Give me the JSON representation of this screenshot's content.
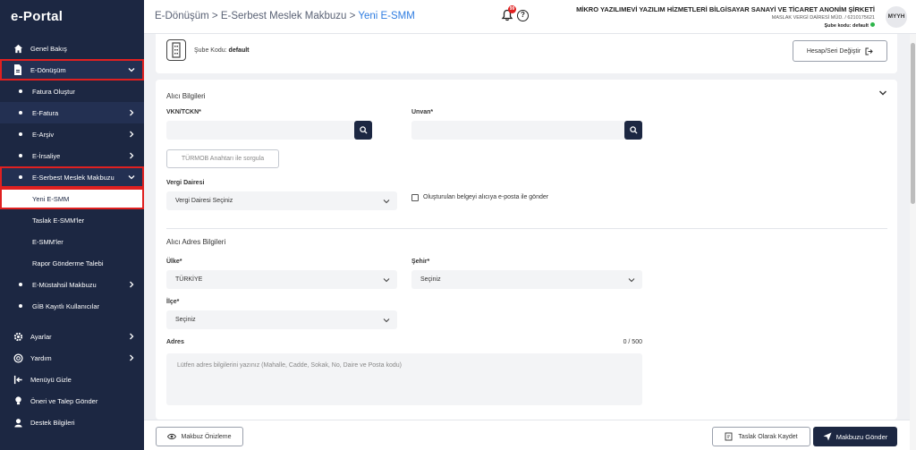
{
  "app": {
    "logo": "e-Portal"
  },
  "sidebar": {
    "items": [
      {
        "label": "Genel Bakış",
        "icon": "home-icon"
      },
      {
        "label": "E-Dönüşüm",
        "icon": "document-icon"
      },
      {
        "label": "Fatura Oluştur"
      },
      {
        "label": "E-Fatura"
      },
      {
        "label": "E-Arşiv"
      },
      {
        "label": "E-İrsaliye"
      },
      {
        "label": "E-Serbest Meslek Makbuzu"
      },
      {
        "label": "Yeni E-SMM"
      },
      {
        "label": "Taslak E-SMM'ler"
      },
      {
        "label": "E-SMM'ler"
      },
      {
        "label": "Rapor Gönderme Talebi"
      },
      {
        "label": "E-Müstahsil Makbuzu"
      },
      {
        "label": "GİB Kayıtlı Kullanıcılar"
      },
      {
        "label": "Ayarlar",
        "icon": "gear-icon"
      },
      {
        "label": "Yardım",
        "icon": "lifebuoy-icon"
      },
      {
        "label": "Menüyü Gizle",
        "icon": "collapse-menu-icon"
      },
      {
        "label": "Öneri ve Talep Gönder",
        "icon": "lightbulb-icon"
      },
      {
        "label": "Destek Bilgileri",
        "icon": "support-icon"
      }
    ]
  },
  "header": {
    "breadcrumb": {
      "part1": "E-Dönüşüm",
      "sep": " > ",
      "part2": "E-Serbest Meslek Makbuzu",
      "current": "Yeni E-SMM"
    },
    "notification_count": "99",
    "company_name": "MİKRO YAZILIMEVİ YAZILIM HİZMETLERİ BİLGİSAYAR SANAYİ VE TİCARET ANONİM ŞİRKETİ",
    "tax_info": "MASLAK VERGİ DAİRESİ MÜD. / 6210175621",
    "branch_label": "Şube kodu: default",
    "avatar": "MYYH"
  },
  "branch": {
    "label": "Şube Kodu:",
    "value": "default",
    "change_button": "Hesap/Seri Değiştir"
  },
  "form": {
    "recipient_title": "Alıcı Bilgileri",
    "vkn_label": "VKN/TCKN*",
    "vkn_value": "",
    "title_label": "Unvan*",
    "title_value": "",
    "turmob_button": "TÜRMOB Anahtarı ile sorgula",
    "tax_office_label": "Vergi Dairesi",
    "tax_office_value": "Vergi Dairesi Seçiniz",
    "email_checkbox": "Oluşturulan belgeyi alıcıya e-posta ile gönder",
    "address_title": "Alıcı Adres Bilgileri",
    "country_label": "Ülke*",
    "country_value": "TÜRKİYE",
    "city_label": "Şehir*",
    "city_value": "Seçiniz",
    "district_label": "İlçe*",
    "district_value": "Seçiniz",
    "address_label": "Adres",
    "address_counter": "0 / 500",
    "address_placeholder": "Lütfen adres bilgilerini yazınız (Mahalle, Cadde, Sokak, No, Daire ve Posta kodu)"
  },
  "footer": {
    "preview_button": "Makbuz Önizleme",
    "draft_button": "Taslak Olarak Kaydet",
    "send_button": "Makbuzu Gönder"
  },
  "colors": {
    "sidebar": "#1c2742",
    "accent": "#2f7de1",
    "highlight": "#e02020",
    "online": "#2db54a"
  }
}
